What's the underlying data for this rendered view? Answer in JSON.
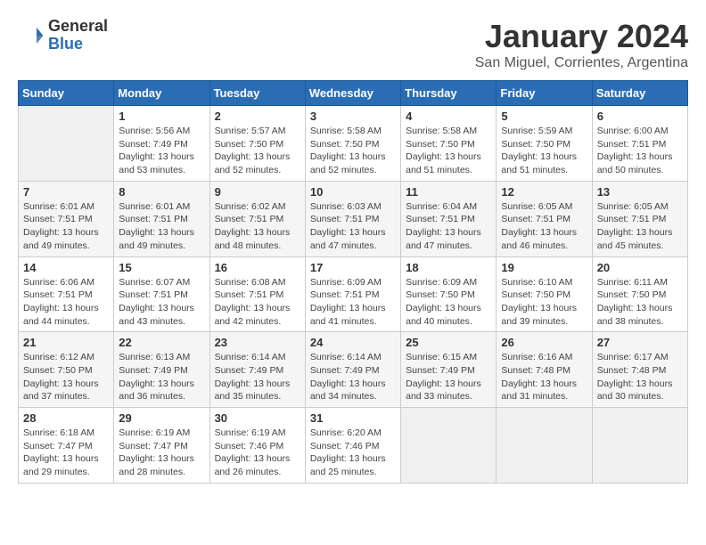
{
  "logo": {
    "general": "General",
    "blue": "Blue"
  },
  "title": "January 2024",
  "subtitle": "San Miguel, Corrientes, Argentina",
  "days_header": [
    "Sunday",
    "Monday",
    "Tuesday",
    "Wednesday",
    "Thursday",
    "Friday",
    "Saturday"
  ],
  "weeks": [
    [
      {
        "day": "",
        "info": ""
      },
      {
        "day": "1",
        "info": "Sunrise: 5:56 AM\nSunset: 7:49 PM\nDaylight: 13 hours\nand 53 minutes."
      },
      {
        "day": "2",
        "info": "Sunrise: 5:57 AM\nSunset: 7:50 PM\nDaylight: 13 hours\nand 52 minutes."
      },
      {
        "day": "3",
        "info": "Sunrise: 5:58 AM\nSunset: 7:50 PM\nDaylight: 13 hours\nand 52 minutes."
      },
      {
        "day": "4",
        "info": "Sunrise: 5:58 AM\nSunset: 7:50 PM\nDaylight: 13 hours\nand 51 minutes."
      },
      {
        "day": "5",
        "info": "Sunrise: 5:59 AM\nSunset: 7:50 PM\nDaylight: 13 hours\nand 51 minutes."
      },
      {
        "day": "6",
        "info": "Sunrise: 6:00 AM\nSunset: 7:51 PM\nDaylight: 13 hours\nand 50 minutes."
      }
    ],
    [
      {
        "day": "7",
        "info": "Sunrise: 6:01 AM\nSunset: 7:51 PM\nDaylight: 13 hours\nand 49 minutes."
      },
      {
        "day": "8",
        "info": "Sunrise: 6:01 AM\nSunset: 7:51 PM\nDaylight: 13 hours\nand 49 minutes."
      },
      {
        "day": "9",
        "info": "Sunrise: 6:02 AM\nSunset: 7:51 PM\nDaylight: 13 hours\nand 48 minutes."
      },
      {
        "day": "10",
        "info": "Sunrise: 6:03 AM\nSunset: 7:51 PM\nDaylight: 13 hours\nand 47 minutes."
      },
      {
        "day": "11",
        "info": "Sunrise: 6:04 AM\nSunset: 7:51 PM\nDaylight: 13 hours\nand 47 minutes."
      },
      {
        "day": "12",
        "info": "Sunrise: 6:05 AM\nSunset: 7:51 PM\nDaylight: 13 hours\nand 46 minutes."
      },
      {
        "day": "13",
        "info": "Sunrise: 6:05 AM\nSunset: 7:51 PM\nDaylight: 13 hours\nand 45 minutes."
      }
    ],
    [
      {
        "day": "14",
        "info": "Sunrise: 6:06 AM\nSunset: 7:51 PM\nDaylight: 13 hours\nand 44 minutes."
      },
      {
        "day": "15",
        "info": "Sunrise: 6:07 AM\nSunset: 7:51 PM\nDaylight: 13 hours\nand 43 minutes."
      },
      {
        "day": "16",
        "info": "Sunrise: 6:08 AM\nSunset: 7:51 PM\nDaylight: 13 hours\nand 42 minutes."
      },
      {
        "day": "17",
        "info": "Sunrise: 6:09 AM\nSunset: 7:51 PM\nDaylight: 13 hours\nand 41 minutes."
      },
      {
        "day": "18",
        "info": "Sunrise: 6:09 AM\nSunset: 7:50 PM\nDaylight: 13 hours\nand 40 minutes."
      },
      {
        "day": "19",
        "info": "Sunrise: 6:10 AM\nSunset: 7:50 PM\nDaylight: 13 hours\nand 39 minutes."
      },
      {
        "day": "20",
        "info": "Sunrise: 6:11 AM\nSunset: 7:50 PM\nDaylight: 13 hours\nand 38 minutes."
      }
    ],
    [
      {
        "day": "21",
        "info": "Sunrise: 6:12 AM\nSunset: 7:50 PM\nDaylight: 13 hours\nand 37 minutes."
      },
      {
        "day": "22",
        "info": "Sunrise: 6:13 AM\nSunset: 7:49 PM\nDaylight: 13 hours\nand 36 minutes."
      },
      {
        "day": "23",
        "info": "Sunrise: 6:14 AM\nSunset: 7:49 PM\nDaylight: 13 hours\nand 35 minutes."
      },
      {
        "day": "24",
        "info": "Sunrise: 6:14 AM\nSunset: 7:49 PM\nDaylight: 13 hours\nand 34 minutes."
      },
      {
        "day": "25",
        "info": "Sunrise: 6:15 AM\nSunset: 7:49 PM\nDaylight: 13 hours\nand 33 minutes."
      },
      {
        "day": "26",
        "info": "Sunrise: 6:16 AM\nSunset: 7:48 PM\nDaylight: 13 hours\nand 31 minutes."
      },
      {
        "day": "27",
        "info": "Sunrise: 6:17 AM\nSunset: 7:48 PM\nDaylight: 13 hours\nand 30 minutes."
      }
    ],
    [
      {
        "day": "28",
        "info": "Sunrise: 6:18 AM\nSunset: 7:47 PM\nDaylight: 13 hours\nand 29 minutes."
      },
      {
        "day": "29",
        "info": "Sunrise: 6:19 AM\nSunset: 7:47 PM\nDaylight: 13 hours\nand 28 minutes."
      },
      {
        "day": "30",
        "info": "Sunrise: 6:19 AM\nSunset: 7:46 PM\nDaylight: 13 hours\nand 26 minutes."
      },
      {
        "day": "31",
        "info": "Sunrise: 6:20 AM\nSunset: 7:46 PM\nDaylight: 13 hours\nand 25 minutes."
      },
      {
        "day": "",
        "info": ""
      },
      {
        "day": "",
        "info": ""
      },
      {
        "day": "",
        "info": ""
      }
    ]
  ]
}
